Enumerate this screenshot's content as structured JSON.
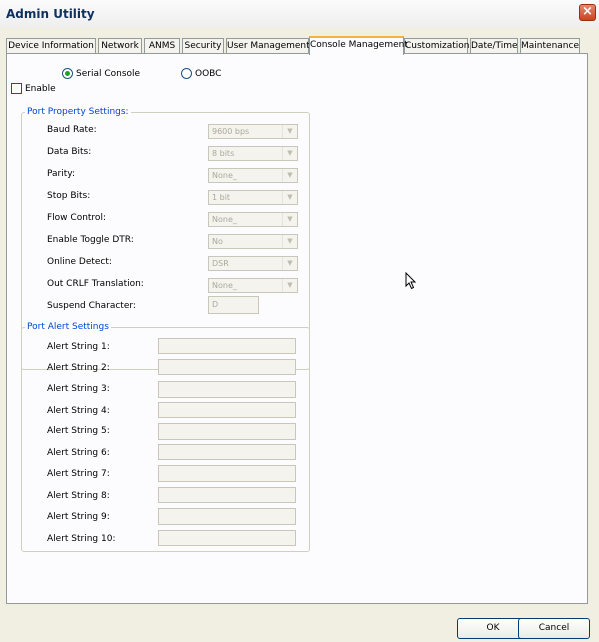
{
  "window": {
    "title": "Admin Utility",
    "close_glyph": "×"
  },
  "tabs": [
    {
      "label": "Device Information",
      "active": false
    },
    {
      "label": "Network",
      "active": false
    },
    {
      "label": "ANMS",
      "active": false
    },
    {
      "label": "Security",
      "active": false
    },
    {
      "label": "User Management",
      "active": false
    },
    {
      "label": "Console Management",
      "active": true
    },
    {
      "label": "Customization",
      "active": false
    },
    {
      "label": "Date/Time",
      "active": false
    },
    {
      "label": "Maintenance",
      "active": false
    }
  ],
  "mode": {
    "serial_label": "Serial Console",
    "serial_selected": true,
    "oobc_label": "OOBC",
    "oobc_selected": false
  },
  "enable": {
    "label": "Enable",
    "checked": false
  },
  "port_property": {
    "legend": "Port Property Settings:",
    "fields": [
      {
        "label": "Baud Rate:",
        "value": "9600 bps"
      },
      {
        "label": "Data Bits:",
        "value": "8 bits"
      },
      {
        "label": "Parity:",
        "value": "None_"
      },
      {
        "label": "Stop Bits:",
        "value": "1 bit"
      },
      {
        "label": "Flow Control:",
        "value": "None_"
      },
      {
        "label": "Enable Toggle DTR:",
        "value": "No"
      },
      {
        "label": "Online Detect:",
        "value": "DSR"
      },
      {
        "label": "Out CRLF Translation:",
        "value": "None_"
      }
    ],
    "suspend": {
      "label": "Suspend Character:",
      "value": "D"
    }
  },
  "port_alert": {
    "legend": "Port Alert Settings",
    "strings": [
      {
        "label": "Alert String 1:",
        "value": ""
      },
      {
        "label": "Alert String 2:",
        "value": ""
      },
      {
        "label": "Alert String 3:",
        "value": ""
      },
      {
        "label": "Alert String 4:",
        "value": ""
      },
      {
        "label": "Alert String 5:",
        "value": ""
      },
      {
        "label": "Alert String 6:",
        "value": ""
      },
      {
        "label": "Alert String 7:",
        "value": ""
      },
      {
        "label": "Alert String 8:",
        "value": ""
      },
      {
        "label": "Alert String 9:",
        "value": ""
      },
      {
        "label": "Alert String 10:",
        "value": ""
      }
    ]
  },
  "buttons": {
    "ok": "OK",
    "cancel": "Cancel"
  },
  "icons": {
    "dropdown": "chevron-down-icon",
    "close": "close-icon",
    "cursor": "mouse-pointer-icon"
  },
  "colors": {
    "title_text": "#10315e",
    "legend_text": "#0046d5",
    "tab_highlight": "#f9b03b",
    "close_button": "#c8451f"
  }
}
